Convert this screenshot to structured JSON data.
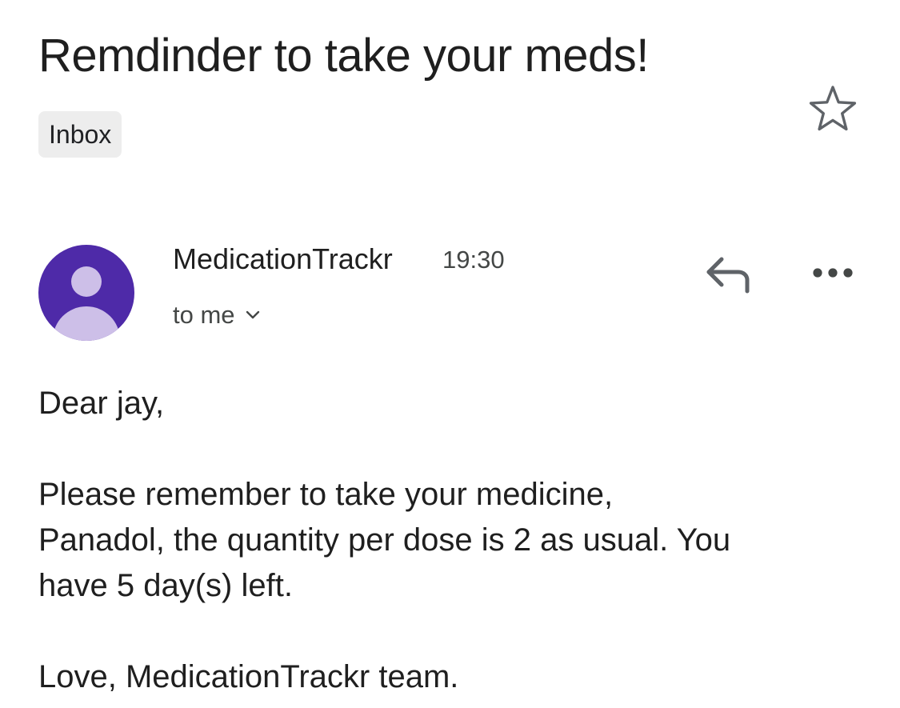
{
  "email": {
    "subject": "Remdinder to take your meds!",
    "label": "Inbox",
    "sender": "MedicationTrackr",
    "time": "19:30",
    "recipient": "to me",
    "body": {
      "greeting": "Dear jay,",
      "line1": "Please remember to take your medicine,",
      "line2": "Panadol, the quantity per dose is 2 as usual. You",
      "line3": "have 5 day(s) left.",
      "signoff": "Love, MedicationTrackr team."
    }
  },
  "icons": {
    "star": "star-outline-icon",
    "reply": "reply-icon",
    "more": "more-horizontal-icon",
    "chevron": "chevron-down-icon",
    "avatar": "default-person-avatar"
  },
  "colors": {
    "avatar_bg": "#4e2aa8",
    "avatar_fg": "#cdbfe8",
    "label_chip_bg": "#ededed",
    "icon_gray": "#5f6368",
    "text_primary": "#1f1f1f",
    "text_secondary": "#444746"
  }
}
